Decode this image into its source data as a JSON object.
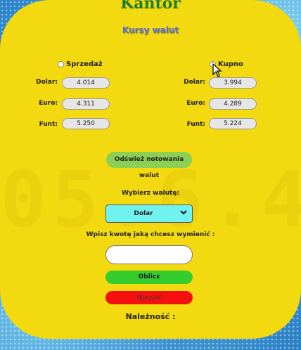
{
  "header": {
    "title": "Kantor",
    "subtitle": "Kursy walut"
  },
  "radios": {
    "sell_label": "Sprzedaż",
    "buy_label": "Kupno"
  },
  "sell_rates": [
    {
      "label": "Dolar:",
      "value": "4.014"
    },
    {
      "label": "Euro:",
      "value": "4.311"
    },
    {
      "label": "Funt:",
      "value": "5.250"
    }
  ],
  "buy_rates": [
    {
      "label": "Dolar:",
      "value": "3.994"
    },
    {
      "label": "Euro:",
      "value": "4.289"
    },
    {
      "label": "Funt:",
      "value": "5.224"
    }
  ],
  "refresh_button": "Odśwież notowania walut",
  "currency_select": {
    "label": "Wybierz walutę:",
    "selected": "Dolar"
  },
  "amount": {
    "label": "Wpisz kwotę jaką chcesz wymienić :",
    "value": ""
  },
  "calculate_button": "Oblicz",
  "clear_button": "Wyczyść",
  "result_label": "Należność :",
  "background_digits": "05.6.4",
  "colors": {
    "panel": "#f3d90f",
    "title": "#1f7d2c",
    "subtitle": "#5b6cd6",
    "refresh": "#8ccf52",
    "select": "#70f3f0",
    "calculate": "#35cc2e",
    "clear": "#f51010"
  }
}
